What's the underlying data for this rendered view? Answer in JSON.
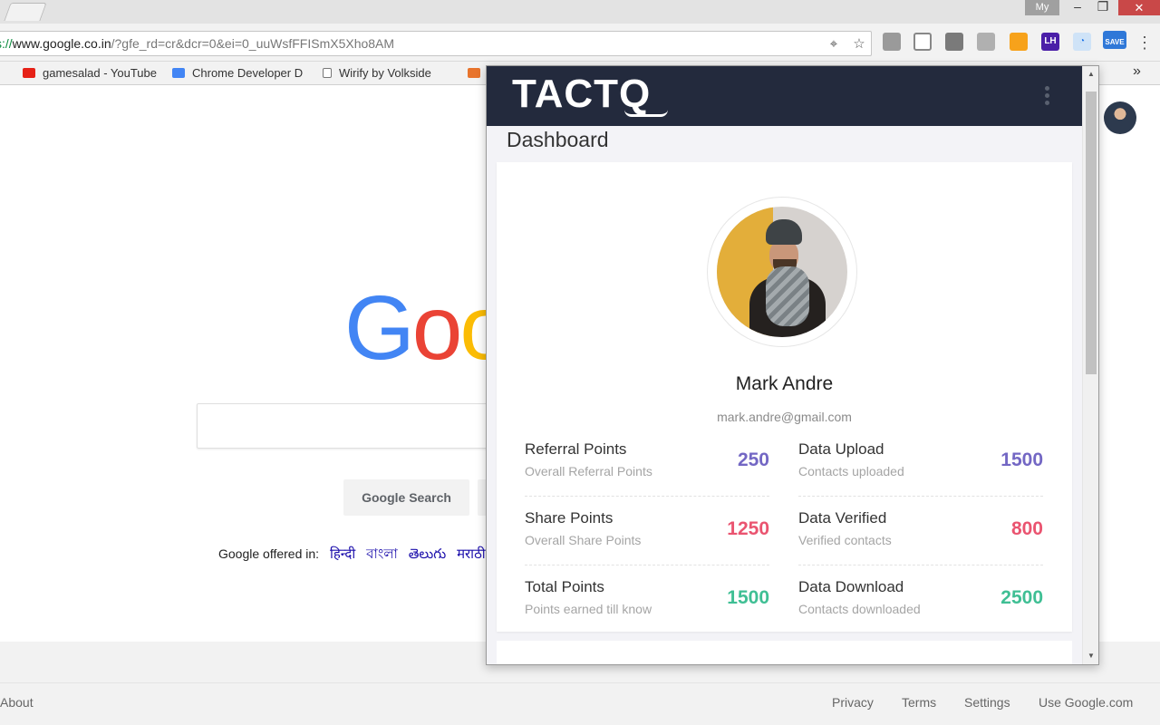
{
  "browser": {
    "window_user": "My",
    "url_scheme": "s://",
    "url_host": "www.google.co.in",
    "url_path": "/?gfe_rd=cr&dcr=0&ei=0_uuWsfFFISmX5Xho8AM",
    "overflow_chevron": "»",
    "bookmarks": [
      {
        "label": "gamesalad - YouTube"
      },
      {
        "label": "Chrome Developer D"
      },
      {
        "label": "Wirify by Volkside"
      }
    ],
    "ext_lh_label": "LH",
    "ext_save_label": "SAVE"
  },
  "google": {
    "search_button": "Google Search",
    "offered_in_label": "Google offered in:",
    "languages": [
      "हिन्दी",
      "বাংলা",
      "తెలుగు",
      "मराठी"
    ],
    "footer_left": [
      "About"
    ],
    "footer_right": [
      "Privacy",
      "Terms",
      "Settings",
      "Use Google.com"
    ]
  },
  "popup": {
    "brand": "TACTQ",
    "title": "Dashboard",
    "profile": {
      "name": "Mark Andre",
      "email": "mark.andre@gmail.com"
    },
    "stats_left": [
      {
        "label": "Referral Points",
        "sub": "Overall Referral Points",
        "value": "250",
        "color": "#7367c4"
      },
      {
        "label": "Share Points",
        "sub": "Overall Share Points",
        "value": "1250",
        "color": "#ea5470"
      },
      {
        "label": "Total Points",
        "sub": "Points earned till know",
        "value": "1500",
        "color": "#3fbf94"
      }
    ],
    "stats_right": [
      {
        "label": "Data Upload",
        "sub": "Contacts uploaded",
        "value": "1500",
        "color": "#7367c4"
      },
      {
        "label": "Data Verified",
        "sub": "Verified contacts",
        "value": "800",
        "color": "#ea5470"
      },
      {
        "label": "Data Download",
        "sub": "Contacts downloaded",
        "value": "2500",
        "color": "#3fbf94"
      }
    ]
  }
}
